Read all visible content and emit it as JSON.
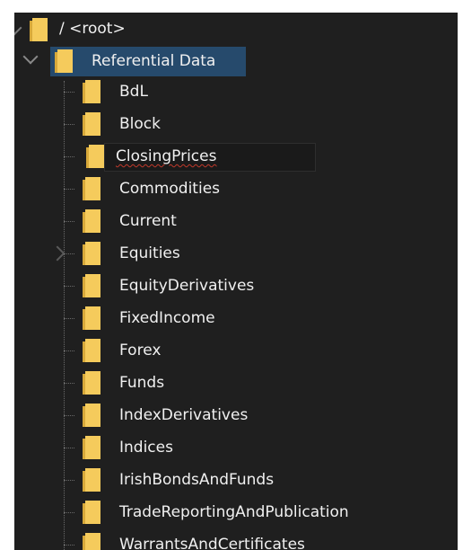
{
  "tree": {
    "root": {
      "label": "/ <root>",
      "expanded": true
    },
    "folder": {
      "label": "Referential Data",
      "expanded": true,
      "selected": true
    },
    "children": [
      {
        "label": "BdL",
        "has_children": false,
        "editing": false
      },
      {
        "label": "Block",
        "has_children": false,
        "editing": false
      },
      {
        "label": "ClosingPrices",
        "has_children": false,
        "editing": true
      },
      {
        "label": "Commodities",
        "has_children": false,
        "editing": false
      },
      {
        "label": "Current",
        "has_children": false,
        "editing": false
      },
      {
        "label": "Equities",
        "has_children": true,
        "editing": false
      },
      {
        "label": "EquityDerivatives",
        "has_children": false,
        "editing": false
      },
      {
        "label": "FixedIncome",
        "has_children": false,
        "editing": false
      },
      {
        "label": "Forex",
        "has_children": false,
        "editing": false
      },
      {
        "label": "Funds",
        "has_children": false,
        "editing": false
      },
      {
        "label": "IndexDerivatives",
        "has_children": false,
        "editing": false
      },
      {
        "label": "Indices",
        "has_children": false,
        "editing": false
      },
      {
        "label": "IrishBondsAndFunds",
        "has_children": false,
        "editing": false
      },
      {
        "label": "TradeReportingAndPublication",
        "has_children": false,
        "editing": false
      },
      {
        "label": "WarrantsAndCertificates",
        "has_children": false,
        "editing": false
      }
    ]
  },
  "colors": {
    "background": "#1f1f1f",
    "selection": "#264a6c",
    "text": "#f0f0f0",
    "folder": "#f5cb5c",
    "folder_dark": "#d8a93a",
    "spellcheck": "#c0392b"
  }
}
